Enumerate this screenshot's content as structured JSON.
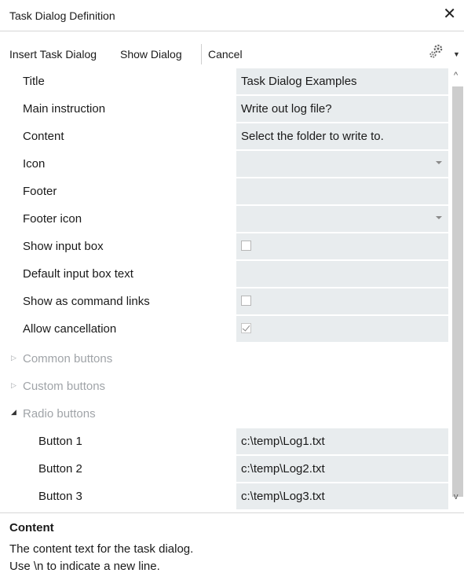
{
  "window": {
    "title": "Task Dialog Definition",
    "close_glyph": "✕"
  },
  "toolbar": {
    "insert_label": "Insert Task Dialog",
    "show_label": "Show Dialog",
    "cancel_label": "Cancel",
    "settings_icon": "gear-icon",
    "dropdown_glyph": "▼"
  },
  "properties": [
    {
      "label": "Title",
      "value": "Task Dialog Examples",
      "kind": "text"
    },
    {
      "label": "Main instruction",
      "value": "Write out log file?",
      "kind": "text"
    },
    {
      "label": "Content",
      "value": "Select the folder to write to.",
      "kind": "text"
    },
    {
      "label": "Icon",
      "value": "",
      "kind": "dropdown"
    },
    {
      "label": "Footer",
      "value": "",
      "kind": "text"
    },
    {
      "label": "Footer icon",
      "value": "",
      "kind": "dropdown"
    },
    {
      "label": "Show input box",
      "checked": false,
      "kind": "checkbox"
    },
    {
      "label": "Default input box text",
      "value": "",
      "kind": "text"
    },
    {
      "label": "Show as command links",
      "checked": false,
      "kind": "checkbox"
    },
    {
      "label": "Allow cancellation",
      "checked": true,
      "kind": "checkbox"
    }
  ],
  "groups": [
    {
      "label": "Common buttons",
      "expanded": false,
      "glyph": "▷"
    },
    {
      "label": "Custom buttons",
      "expanded": false,
      "glyph": "▷"
    },
    {
      "label": "Radio buttons",
      "expanded": true,
      "glyph": "◢"
    }
  ],
  "radio_buttons": [
    {
      "label": "Button 1",
      "value": "c:\\temp\\Log1.txt"
    },
    {
      "label": "Button 2",
      "value": "c:\\temp\\Log2.txt"
    },
    {
      "label": "Button 3",
      "value": "c:\\temp\\Log3.txt"
    }
  ],
  "scrollbar": {
    "up_glyph": "^",
    "down_glyph": "v"
  },
  "description": {
    "heading": "Content",
    "line1": "The content text for the task dialog.",
    "line2": "Use \\n to indicate a new line."
  },
  "colors": {
    "value_bg": "#e8ecee",
    "group_text": "#a0a4a8"
  }
}
